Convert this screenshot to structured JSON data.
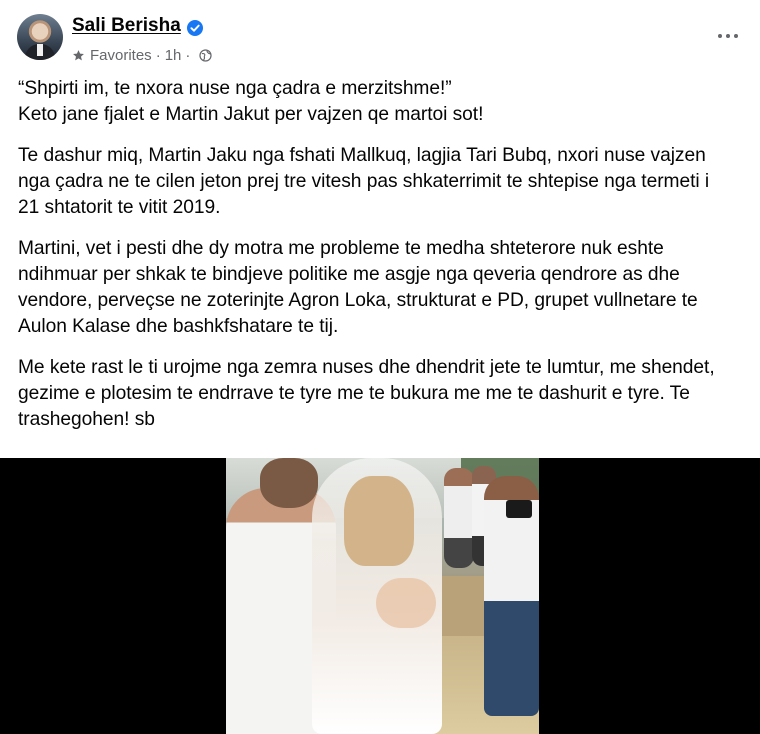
{
  "post": {
    "author": "Sali Berisha",
    "audience_label": "Favorites",
    "separator": "·",
    "timestamp": "1h",
    "separator2": "·",
    "icons": {
      "verified": "verified-badge-icon",
      "favorites": "star-icon",
      "privacy": "globe-icon",
      "more": "more-options-icon"
    },
    "colors": {
      "verified": "#1877f2",
      "meta_text": "#65676b",
      "body_text": "#050505"
    },
    "paragraphs": [
      "“Shpirti im, te nxora nuse nga çadra e merzitshme!”\n Keto jane fjalet e Martin Jakut per vajzen qe martoi sot!",
      "Te dashur miq, Martin Jaku nga fshati Mallkuq, lagjia Tari Bubq, nxori nuse vajzen nga çadra ne te cilen jeton prej tre vitesh pas shkaterrimit te shtepise nga termeti i 21 shtatorit te vitit 2019.",
      "Martini, vet i pesti dhe dy motra me probleme te medha shteterore nuk eshte ndihmuar per shkak te bindjeve politike me asgje nga qeveria qendrore as dhe vendore, perveçse ne zoterinjte Agron Loka, strukturat e PD, grupet vullnetare te Aulon Kalase dhe bashkfshatare te tij.",
      "Me kete rast le ti urojme nga zemra nuses dhe dhendrit jete te lumtur, me shendet, gezime e plotesim te endrrave te tyre me te bukura me me te dashurit e tyre. Te trashegohen! sb"
    ]
  }
}
